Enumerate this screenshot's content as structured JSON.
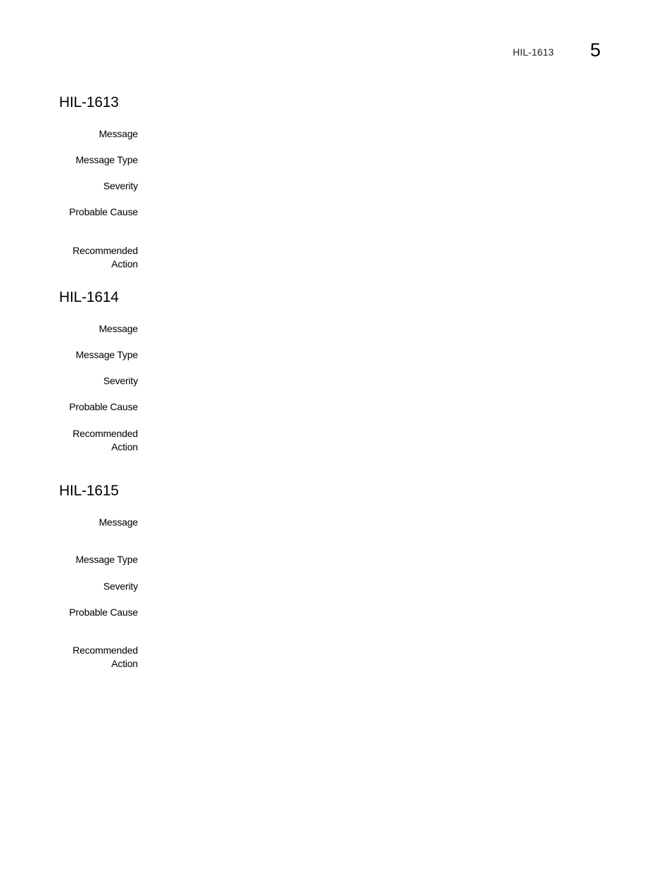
{
  "header": {
    "running_title": "HIL-1613",
    "chapter_number": "5"
  },
  "sections": [
    {
      "title": "HIL-1613",
      "fields": [
        {
          "label": "Message",
          "value": ""
        },
        {
          "label": "Message Type",
          "value": ""
        },
        {
          "label": "Severity",
          "value": ""
        },
        {
          "label": "Probable Cause",
          "value": ""
        },
        {
          "label": "Recommended\nAction",
          "value": ""
        }
      ]
    },
    {
      "title": "HIL-1614",
      "fields": [
        {
          "label": "Message",
          "value": ""
        },
        {
          "label": "Message Type",
          "value": ""
        },
        {
          "label": "Severity",
          "value": ""
        },
        {
          "label": "Probable Cause",
          "value": ""
        },
        {
          "label": "Recommended\nAction",
          "value": ""
        }
      ]
    },
    {
      "title": "HIL-1615",
      "fields": [
        {
          "label": "Message",
          "value": ""
        },
        {
          "label": "Message Type",
          "value": ""
        },
        {
          "label": "Severity",
          "value": ""
        },
        {
          "label": "Probable Cause",
          "value": ""
        },
        {
          "label": "Recommended\nAction",
          "value": ""
        }
      ]
    }
  ]
}
